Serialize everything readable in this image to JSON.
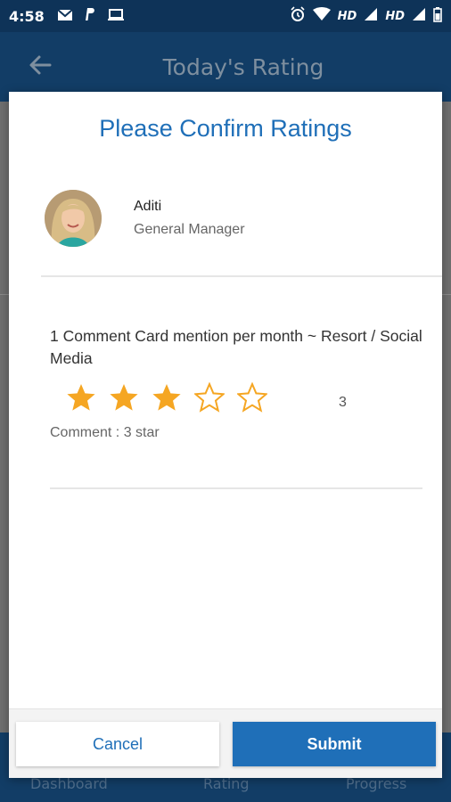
{
  "status_bar": {
    "time": "4:58",
    "left_icons": [
      "gmail-icon",
      "paypal-icon",
      "laptop-icon"
    ],
    "right_labels": [
      "HD",
      "HD"
    ]
  },
  "app_bar": {
    "title": "Today's Rating"
  },
  "bottom_nav": {
    "items": [
      "Dashboard",
      "Rating",
      "Progress"
    ]
  },
  "dialog": {
    "title": "Please Confirm Ratings",
    "person": {
      "name": "Aditi",
      "role": "General Manager"
    },
    "rating": {
      "title": "1 Comment Card mention per month ~ Resort / Social Media",
      "stars_total": 5,
      "stars_filled": 3,
      "value": "3",
      "comment": "Comment : 3 star"
    },
    "buttons": {
      "cancel": "Cancel",
      "submit": "Submit"
    }
  },
  "colors": {
    "accent": "#1f6fb8",
    "star": "#f5a623",
    "app_bar": "#123d66"
  }
}
